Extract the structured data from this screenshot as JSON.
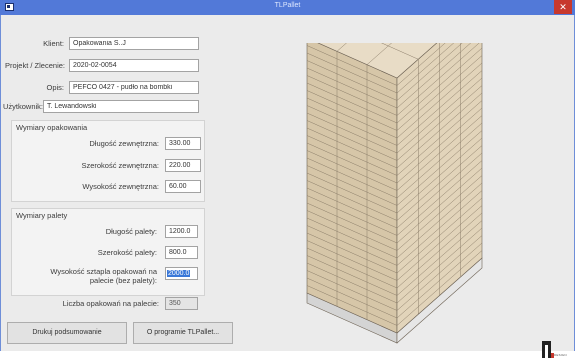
{
  "window": {
    "title": "TLPallet",
    "close_glyph": "✕",
    "app_icon": "app-icon",
    "accent": "#5279d8",
    "close_color": "#c7382d"
  },
  "form": {
    "klient_label": "Klient:",
    "klient_value": "Opakowania S..J",
    "projekt_label": "Projekt / Zlecenie:",
    "projekt_value": "2020-02-0054",
    "opis_label": "Opis:",
    "opis_value": "PEFCO 0427 - pudło na bombki",
    "uzytkownik_label": "Użytkownik:",
    "uzytkownik_value": "T. Lewandowski"
  },
  "opakowanie": {
    "group_title": "Wymiary opakowania",
    "dlugosc_label": "Długość zewnętrzna:",
    "dlugosc_value": "330.00",
    "szerokosc_label": "Szerokość zewnętrzna:",
    "szerokosc_value": "220.00",
    "wysokosc_label": "Wysokość zewnętrzna:",
    "wysokosc_value": "60.00"
  },
  "paleta": {
    "group_title": "Wymiary palety",
    "dlugosc_label": "Długość palety:",
    "dlugosc_value": "1200.0",
    "szerokosc_label": "Szerokość palety:",
    "szerokosc_value": "800.0",
    "wysokosc_label_line1": "Wysokość sztapla opakowań na",
    "wysokosc_label_line2": "palecie (bez palety):",
    "wysokosc_value": "2000.0"
  },
  "liczba": {
    "label": "Liczba opakowań na palecie:",
    "value": "350"
  },
  "buttons": {
    "drukuj": "Drukuj podsumowanie",
    "o_programie": "O programie TLPallet..."
  },
  "logo": {
    "text": "DESIGN"
  },
  "render": {
    "box_face_top": "#e8dcc6",
    "box_face_left": "#d6c6a8",
    "box_face_right": "#e2d4ba",
    "pallet_color": "#d4d4d4"
  }
}
